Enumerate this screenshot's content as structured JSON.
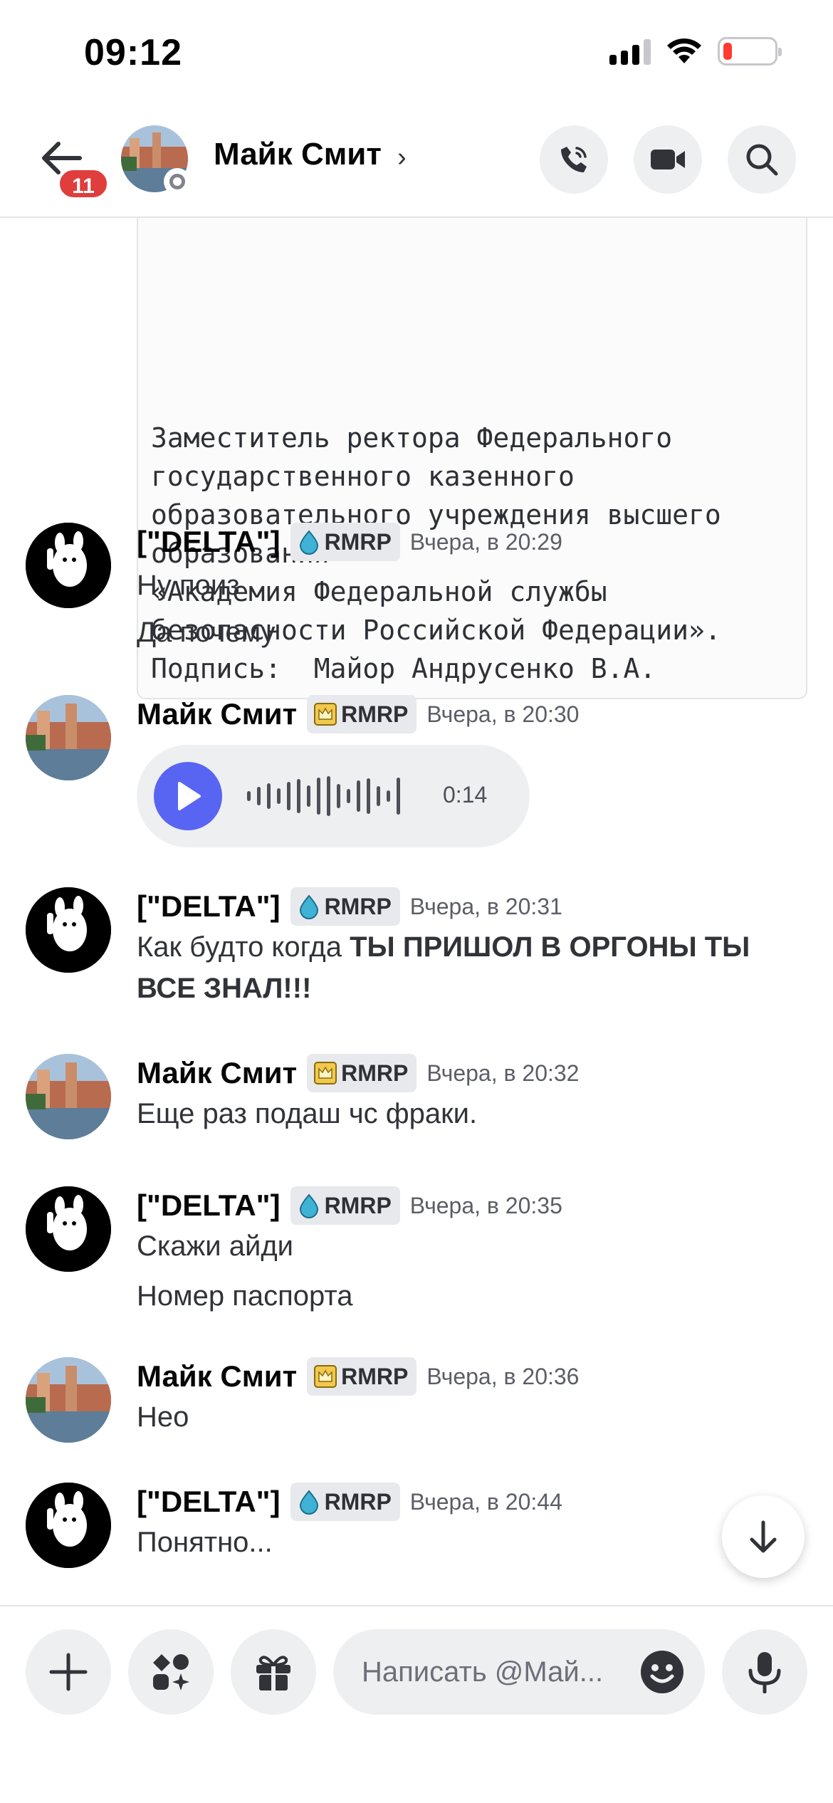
{
  "status_bar": {
    "time": "09:12"
  },
  "header": {
    "name": "Майк Смит",
    "chevron": "›",
    "unread_count": "11"
  },
  "document": {
    "text": "Заместитель ректора Федерального\nгосударственного казенного\nобразовательного учреждения высшего\nобразования\n«Академия Федеральной службы\nбезопасности Российской Федерации».\nПодпись:  Майор Андрусенко В.А."
  },
  "messages": [
    {
      "author": "[\"DELTA\"]",
      "tag": "RMRP",
      "tag_icon": "droplet-icon",
      "time": "Вчера, в 20:29",
      "lines": [
        "Ну поиз",
        "Да почему"
      ]
    },
    {
      "author": "Майк Смит",
      "tag": "RMRP",
      "tag_icon": "crown-icon",
      "time": "Вчера, в 20:30",
      "voice_duration": "0:14"
    },
    {
      "author": "[\"DELTA\"]",
      "tag": "RMRP",
      "tag_icon": "droplet-icon",
      "time": "Вчера, в 20:31",
      "line1_normal": "Как будто когда ",
      "line1_bold": "ТЫ ПРИШОЛ В ОРГОНЫ ТЫ",
      "line2_bold": "ВСЕ ЗНАЛ!!!"
    },
    {
      "author": "Майк Смит",
      "tag": "RMRP",
      "tag_icon": "crown-icon",
      "time": "Вчера, в 20:32",
      "lines": [
        "Еще раз подаш чс фраки."
      ]
    },
    {
      "author": "[\"DELTA\"]",
      "tag": "RMRP",
      "tag_icon": "droplet-icon",
      "time": "Вчера, в 20:35",
      "lines": [
        "Скажи айди",
        "Номер паспорта"
      ]
    },
    {
      "author": "Майк Смит",
      "tag": "RMRP",
      "tag_icon": "crown-icon",
      "time": "Вчера, в 20:36",
      "lines": [
        "Нео"
      ]
    },
    {
      "author": "[\"DELTA\"]",
      "tag": "RMRP",
      "tag_icon": "droplet-icon",
      "time": "Вчера, в 20:44",
      "lines": [
        "Понятно..."
      ]
    }
  ],
  "composer": {
    "placeholder": "Написать @Май..."
  },
  "colors": {
    "accent": "#5865f2",
    "badge": "#e03d3d",
    "surface": "#eeeff1"
  }
}
